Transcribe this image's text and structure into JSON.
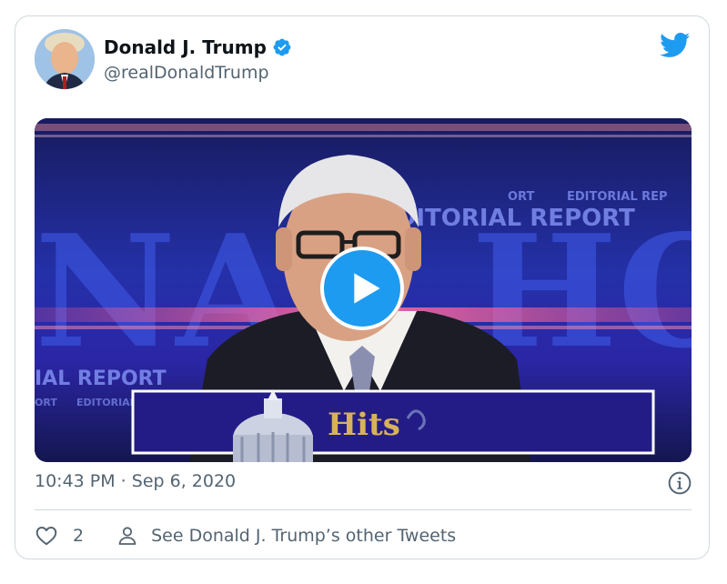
{
  "tweet": {
    "author_name": "Donald J. Trump",
    "author_handle": "@realDonaldTrump",
    "timestamp": "10:43 PM · Sep 6, 2020",
    "like_count": "2",
    "other_tweets_label": "See Donald J. Trump’s other Tweets",
    "verified": true
  },
  "video": {
    "overlay_text": [
      "EDITORIAL REPORT",
      "ORT",
      "EDITORIAL REP",
      "IAL REPORT",
      "ORT",
      "EDITORIAL",
      "NAL",
      "HOU",
      "Hits"
    ],
    "state": "paused"
  },
  "icons": [
    "verified-badge-icon",
    "twitter-bird-icon",
    "play-icon",
    "info-icon",
    "heart-icon",
    "person-icon"
  ],
  "colors": {
    "accent": "#1d9bf0",
    "text_secondary": "#536471",
    "border": "#cfd9de"
  }
}
